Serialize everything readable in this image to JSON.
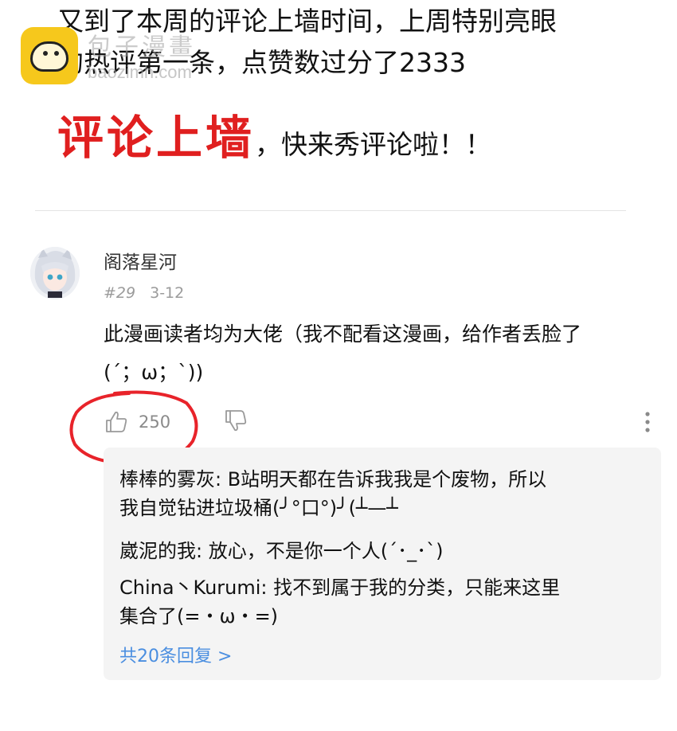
{
  "headline": {
    "line1": "又到了本周的评论上墙时间，上周特别亮眼",
    "line2": "的热评第一条，点赞数过分了2333"
  },
  "watermark": {
    "name": "包子漫畫",
    "domain": "baozimh.com"
  },
  "banner": {
    "big": "评论上墙",
    "small": "，快来秀评论啦！！"
  },
  "comment": {
    "username": "阁落星河",
    "floor": "#29",
    "date": "3-12",
    "text_line1": "此漫画读者均为大佬（我不配看这漫画，给作者丢脸了",
    "text_line2": "(´；ω；`))",
    "likes": "250",
    "replies": [
      {
        "line1": "棒棒的雾灰: B站明天都在告诉我我是个废物，所以",
        "line2": "我自觉钻进垃圾桶(╯°口°)╯(┴—┴"
      },
      {
        "line1": "崴泥的我: 放心，不是你一个人(´･_･`)"
      },
      {
        "line1": "China丶Kurumi: 找不到属于我的分类，只能来这里",
        "line2": "集合了(=・ω・=)"
      }
    ],
    "more_replies": "共20条回复 >"
  },
  "colors": {
    "accent_red": "#e01f1f",
    "link_blue": "#4a8ee0",
    "reply_bg": "#f4f4f4",
    "watermark_yellow": "#f6c81c"
  }
}
